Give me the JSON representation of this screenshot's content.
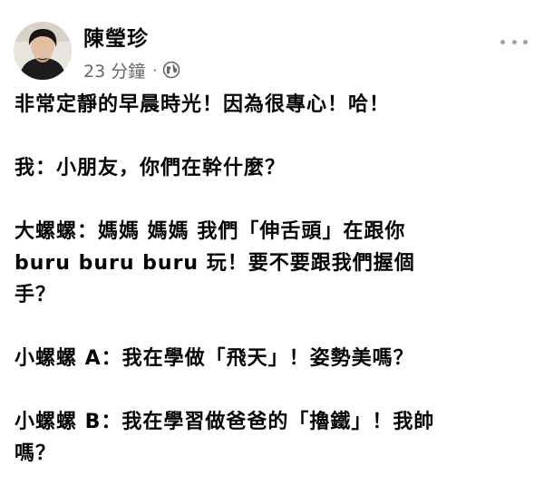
{
  "post": {
    "author": "陳瑩珍",
    "time": "23 分鐘",
    "separator": "·",
    "privacy_icon": "globe-icon",
    "more_icon": "more-options-icon",
    "lines": [
      "非常定靜的早晨時光！因為很專心！哈！",
      "我：小朋友，你們在幹什麼？",
      "大螺螺：媽媽 媽媽 我們「伸舌頭」在跟你",
      "buru buru buru 玩！要不要跟我們握個",
      "手？",
      "小螺螺 A：我在學做「飛天」！姿勢美嗎？",
      "小螺螺 B：我在學習做爸爸的「擼鐵」！我帥",
      "嗎？"
    ]
  },
  "colors": {
    "text": "#050505",
    "meta": "#65676b",
    "dots": "#a0a3a8"
  }
}
